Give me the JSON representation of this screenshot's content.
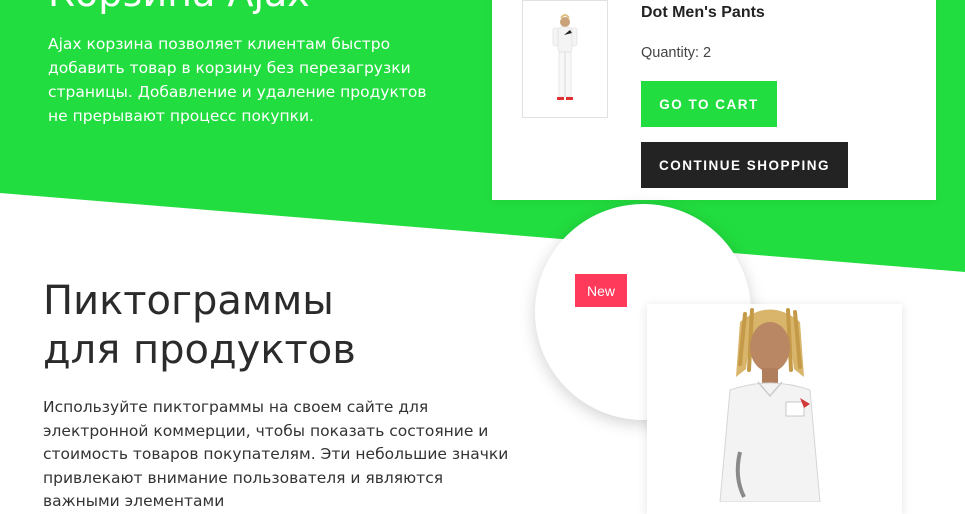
{
  "colors": {
    "accent": "#22dd3f",
    "dark_button": "#232323",
    "badge": "#ff3a5a"
  },
  "hero": {
    "title": "Корзина Ajax",
    "description": "Ajax корзина позволяет клиентам быстро добавить товар в корзину без перезагрузки страницы. Добавление и удаление продуктов не прерывают процесс покупки."
  },
  "cart_popup": {
    "product_name": "Dot Men's Pants",
    "quantity_label": "Quantity:",
    "quantity_value": "2",
    "go_to_cart_label": "GO TO CART",
    "continue_shopping_label": "CONTINUE SHOPPING"
  },
  "pictograms": {
    "title_line1": "Пиктограммы",
    "title_line2": "для продуктов",
    "description": "Используйте пиктограммы на своем сайте для электронной коммерции, чтобы показать состояние и стоимость товаров покупателям. Эти небольшие значки привлекают внимание пользователя и являются важными элементами",
    "badge_label": "New"
  }
}
